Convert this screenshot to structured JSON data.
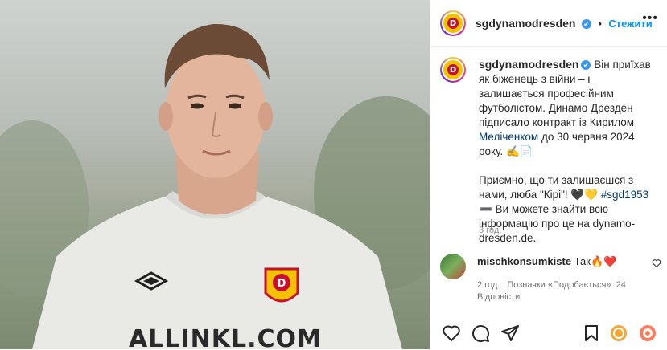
{
  "post": {
    "shirt_sponsor": "ALLINKL.COM"
  },
  "header": {
    "username": "sgdynamodresden",
    "follow_label": "Стежити",
    "verified_mark": "✔",
    "logo_letter": "D"
  },
  "caption": {
    "username": "sgdynamodresden",
    "part1": "Він приїхав як біженець з війни – і залишається професійним футболістом. Динамо Дрезден підписало контракт із Кирилом ",
    "mention": "Меліченком",
    "part2": " до 30 червня 2024 року. ✍️📄",
    "para2_a": "Приємно, що ти залишаєшся з нами, люба \"Кірі\"! 🖤💛 ",
    "hashtag": "#sgd1953",
    "para2_b": "➖ Ви можете знайти всю інформацію про це на dynamo-dresden.de.",
    "time": "3 год."
  },
  "comment": {
    "username": "mischkonsumkiste",
    "text": "Так🔥❤️",
    "time": "2 год.",
    "likes": "Позначки «Подобається»: 24",
    "reply": "Відповісти"
  },
  "actions": [
    {
      "name": "like-icon"
    },
    {
      "name": "comment-icon"
    },
    {
      "name": "share-icon"
    },
    {
      "name": "save-icon"
    }
  ]
}
